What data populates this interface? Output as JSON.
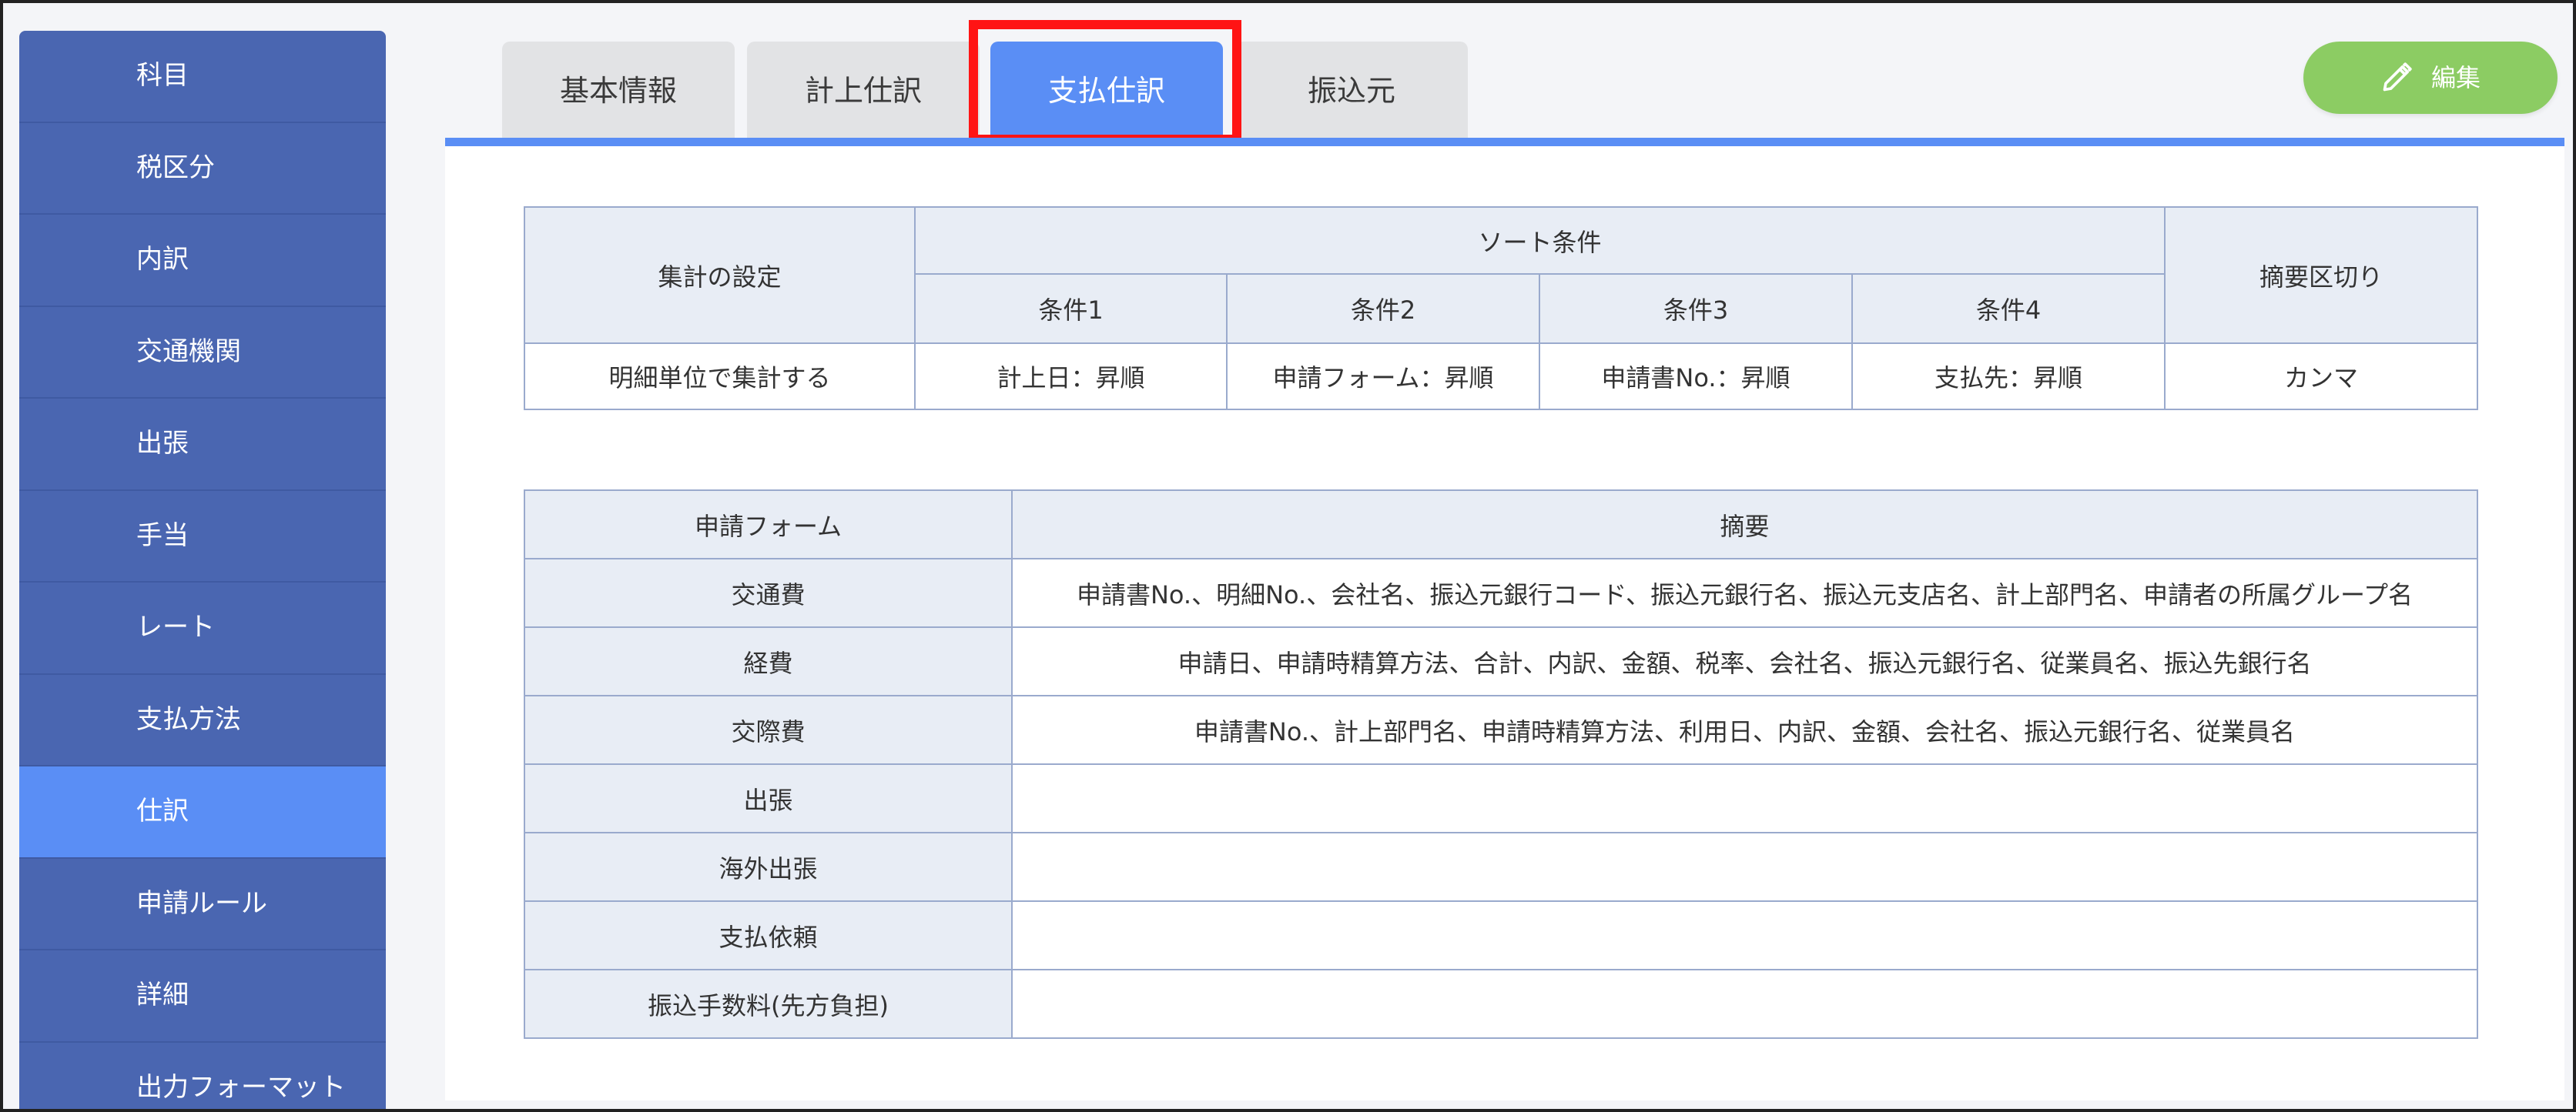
{
  "sidebar": {
    "items": [
      {
        "label": "科目"
      },
      {
        "label": "税区分"
      },
      {
        "label": "内訳"
      },
      {
        "label": "交通機関"
      },
      {
        "label": "出張"
      },
      {
        "label": "手当"
      },
      {
        "label": "レート"
      },
      {
        "label": "支払方法"
      },
      {
        "label": "仕訳",
        "active": true
      },
      {
        "label": "申請ルール"
      },
      {
        "label": "詳細"
      },
      {
        "label": "出力フォーマット"
      }
    ]
  },
  "tabs": [
    {
      "label": "基本情報"
    },
    {
      "label": "計上仕訳"
    },
    {
      "label": "支払仕訳",
      "active": true
    },
    {
      "label": "振込元"
    }
  ],
  "edit_button": {
    "label": "編集",
    "icon": "pencil-icon"
  },
  "settings_table": {
    "aggregate_header": "集計の設定",
    "sort_header": "ソート条件",
    "summary_sep_header": "摘要区切り",
    "conditions": [
      "条件1",
      "条件2",
      "条件3",
      "条件4"
    ],
    "aggregate_value": "明細単位で集計する",
    "condition_values": [
      "計上日：昇順",
      "申請フォーム：昇順",
      "申請書No.：昇順",
      "支払先：昇順"
    ],
    "summary_sep_value": "カンマ"
  },
  "summary_table": {
    "headers": {
      "form": "申請フォーム",
      "summary": "摘要"
    },
    "rows": [
      {
        "form": "交通費",
        "summary": "申請書No.、明細No.、会社名、振込元銀行コード、振込元銀行名、振込元支店名、計上部門名、申請者の所属グループ名"
      },
      {
        "form": "経費",
        "summary": "申請日、申請時精算方法、合計、内訳、金額、税率、会社名、振込元銀行名、従業員名、振込先銀行名"
      },
      {
        "form": "交際費",
        "summary": "申請書No.、計上部門名、申請時精算方法、利用日、内訳、金額、会社名、振込元銀行名、従業員名"
      },
      {
        "form": "出張",
        "summary": ""
      },
      {
        "form": "海外出張",
        "summary": ""
      },
      {
        "form": "支払依頼",
        "summary": ""
      },
      {
        "form": "振込手数料(先方負担)",
        "summary": ""
      }
    ]
  },
  "colors": {
    "sidebar": "#4a66b1",
    "accent": "#5a8ef5",
    "highlight": "#ff1414",
    "edit_button": "#8ccc63",
    "table_header": "#e8edf5",
    "table_border": "#9aaacd"
  }
}
